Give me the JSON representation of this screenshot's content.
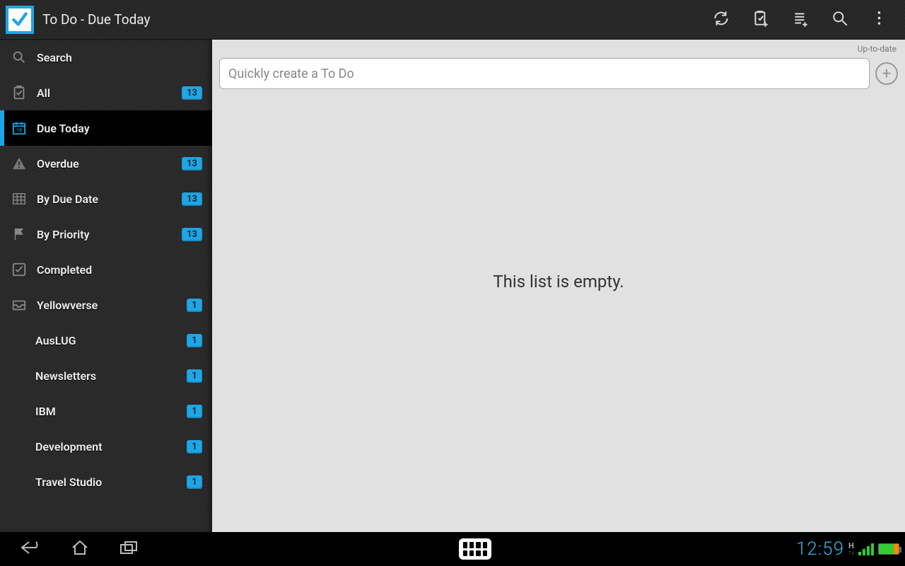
{
  "header": {
    "title": "To Do - Due Today"
  },
  "sidebar": {
    "items": [
      {
        "id": "search",
        "label": "Search",
        "icon": "search",
        "badge": null,
        "selected": false,
        "sub": false
      },
      {
        "id": "all",
        "label": "All",
        "icon": "clipboard",
        "badge": "13",
        "selected": false,
        "sub": false
      },
      {
        "id": "due-today",
        "label": "Due Today",
        "icon": "calendar",
        "badge": null,
        "selected": true,
        "sub": false
      },
      {
        "id": "overdue",
        "label": "Overdue",
        "icon": "warning",
        "badge": "13",
        "selected": false,
        "sub": false
      },
      {
        "id": "by-due-date",
        "label": "By Due Date",
        "icon": "grid",
        "badge": "13",
        "selected": false,
        "sub": false
      },
      {
        "id": "by-priority",
        "label": "By Priority",
        "icon": "flag",
        "badge": "13",
        "selected": false,
        "sub": false
      },
      {
        "id": "completed",
        "label": "Completed",
        "icon": "check",
        "badge": null,
        "selected": false,
        "sub": false
      },
      {
        "id": "yellowverse",
        "label": "Yellowverse",
        "icon": "inbox",
        "badge": "1",
        "selected": false,
        "sub": false
      },
      {
        "id": "auslug",
        "label": "AusLUG",
        "icon": null,
        "badge": "1",
        "selected": false,
        "sub": true
      },
      {
        "id": "newsletters",
        "label": "Newsletters",
        "icon": null,
        "badge": "1",
        "selected": false,
        "sub": true
      },
      {
        "id": "ibm",
        "label": "IBM",
        "icon": null,
        "badge": "1",
        "selected": false,
        "sub": true
      },
      {
        "id": "development",
        "label": "Development",
        "icon": null,
        "badge": "1",
        "selected": false,
        "sub": true
      },
      {
        "id": "travel-studio",
        "label": "Travel Studio",
        "icon": null,
        "badge": "1",
        "selected": false,
        "sub": true
      }
    ]
  },
  "main": {
    "status": "Up-to-date",
    "create_placeholder": "Quickly create a To Do",
    "empty_message": "This list is empty."
  },
  "navbar": {
    "clock": "12:59",
    "network_indicator": "H"
  }
}
